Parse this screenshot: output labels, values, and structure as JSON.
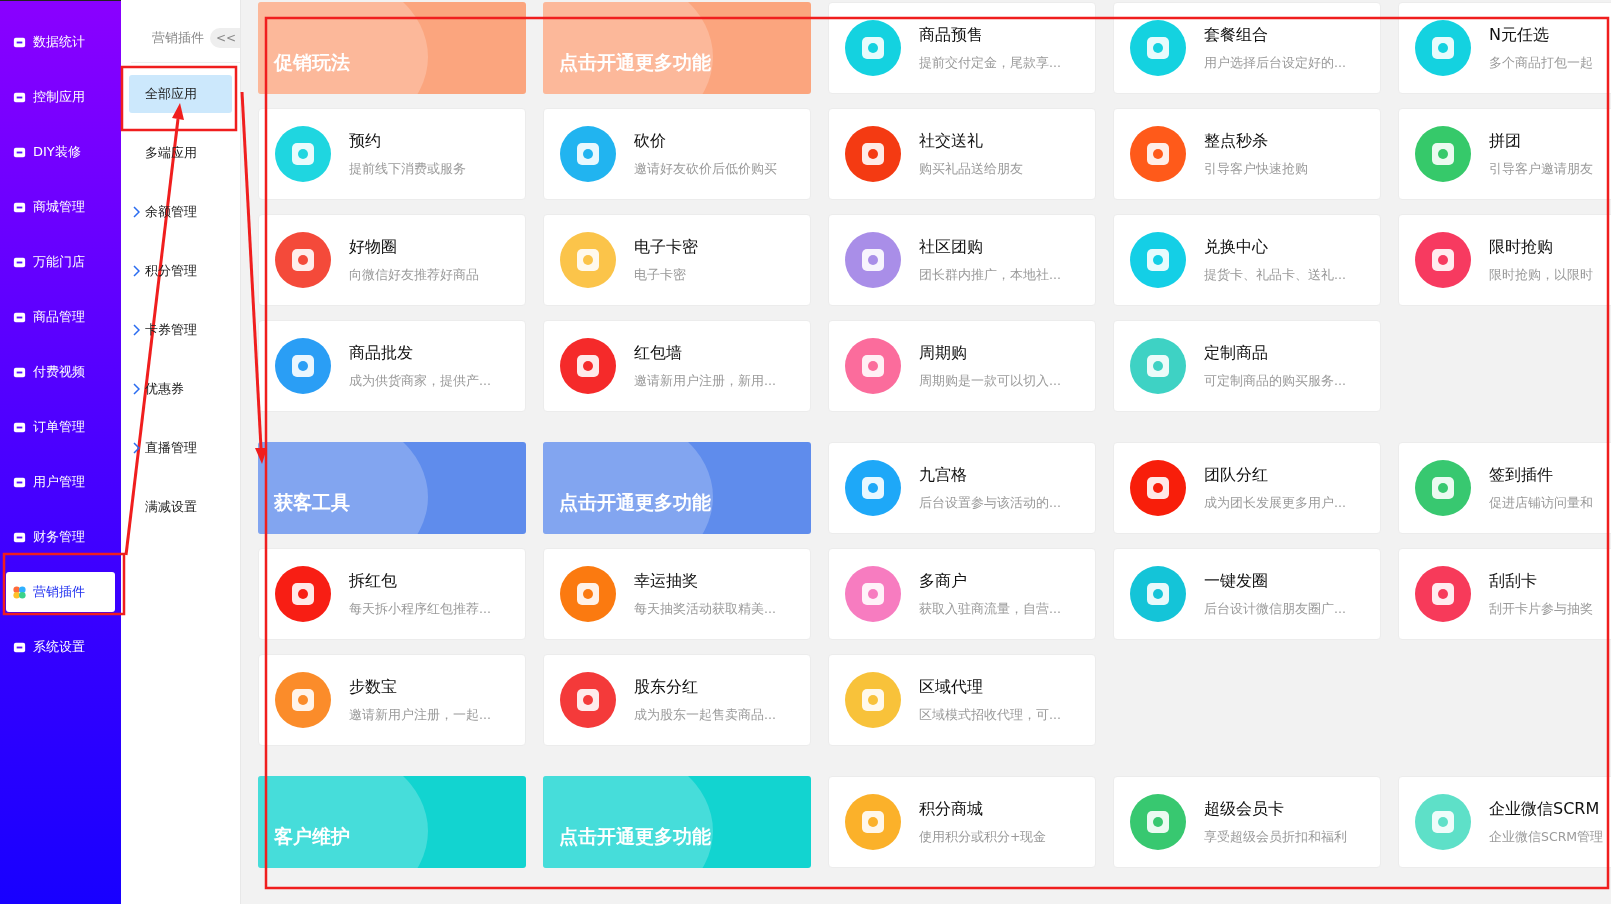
{
  "sidebar": {
    "items": [
      {
        "label": "数据统计",
        "selected": false
      },
      {
        "label": "控制应用",
        "selected": false
      },
      {
        "label": "DIY装修",
        "selected": false
      },
      {
        "label": "商城管理",
        "selected": false
      },
      {
        "label": "万能门店",
        "selected": false
      },
      {
        "label": "商品管理",
        "selected": false
      },
      {
        "label": "付费视频",
        "selected": false
      },
      {
        "label": "订单管理",
        "selected": false
      },
      {
        "label": "用户管理",
        "selected": false
      },
      {
        "label": "财务管理",
        "selected": false
      },
      {
        "label": "营销插件",
        "selected": true
      },
      {
        "label": "系统设置",
        "selected": false
      }
    ]
  },
  "submenu": {
    "title": "营销插件",
    "collapse": "<<",
    "items": [
      {
        "label": "全部应用",
        "kind": "link",
        "selected": true
      },
      {
        "label": "多端应用",
        "kind": "link",
        "selected": false
      },
      {
        "label": "余额管理",
        "kind": "group",
        "selected": false
      },
      {
        "label": "积分管理",
        "kind": "group",
        "selected": false
      },
      {
        "label": "卡券管理",
        "kind": "group",
        "selected": false
      },
      {
        "label": "优惠券",
        "kind": "group",
        "selected": false
      },
      {
        "label": "直播管理",
        "kind": "group",
        "selected": false
      },
      {
        "label": "满减设置",
        "kind": "link",
        "selected": false
      }
    ]
  },
  "sections": [
    {
      "color": "#fba57e",
      "banners": [
        "促销玩法",
        "点击开通更多功能"
      ],
      "apps": [
        {
          "title": "商品预售",
          "desc": "提前交付定金，尾款享...",
          "color": "#14d2e0"
        },
        {
          "title": "套餐组合",
          "desc": "用户选择后台设定好的...",
          "color": "#14d2e0"
        },
        {
          "title": "N元任选",
          "desc": "多个商品打包一起",
          "color": "#14d2e0"
        },
        {
          "title": "预约",
          "desc": "提前线下消费或服务",
          "color": "#1fd6e0"
        },
        {
          "title": "砍价",
          "desc": "邀请好友砍价后低价购买",
          "color": "#21b4f0"
        },
        {
          "title": "社交送礼",
          "desc": "购买礼品送给朋友",
          "color": "#f43a12"
        },
        {
          "title": "整点秒杀",
          "desc": "引导客户快速抢购",
          "color": "#ff5a1a"
        },
        {
          "title": "拼团",
          "desc": "引导客户邀请朋友",
          "color": "#36c96a"
        },
        {
          "title": "好物圈",
          "desc": "向微信好友推荐好商品",
          "color": "#f44a3a"
        },
        {
          "title": "电子卡密",
          "desc": "电子卡密",
          "color": "#fbc44a"
        },
        {
          "title": "社区团购",
          "desc": "团长群内推广，本地社...",
          "color": "#a98ee8"
        },
        {
          "title": "兑换中心",
          "desc": "提货卡、礼品卡、送礼...",
          "color": "#14cfe6"
        },
        {
          "title": "限时抢购",
          "desc": "限时抢购，以限时",
          "color": "#f73a60"
        },
        {
          "title": "商品批发",
          "desc": "成为供货商家，提供产...",
          "color": "#2a9ef5"
        },
        {
          "title": "红包墙",
          "desc": "邀请新用户注册，新用...",
          "color": "#f52a2a"
        },
        {
          "title": "周期购",
          "desc": "周期购是一款可以切入...",
          "color": "#fb6c9c"
        },
        {
          "title": "定制商品",
          "desc": "可定制商品的购买服务...",
          "color": "#3ed2c4"
        }
      ]
    },
    {
      "color": "#5f8cec",
      "banners": [
        "获客工具",
        "点击开通更多功能"
      ],
      "apps": [
        {
          "title": "九宫格",
          "desc": "后台设置参与该活动的...",
          "color": "#1ea8f8"
        },
        {
          "title": "团队分红",
          "desc": "成为团长发展更多用户...",
          "color": "#f81e0a"
        },
        {
          "title": "签到插件",
          "desc": "促进店铺访问量和",
          "color": "#38c870"
        },
        {
          "title": "拆红包",
          "desc": "每天拆小程序红包推荐...",
          "color": "#f81e14"
        },
        {
          "title": "幸运抽奖",
          "desc": "每天抽奖活动获取精美...",
          "color": "#fb7a10"
        },
        {
          "title": "多商户",
          "desc": "获取入驻商流量，自营...",
          "color": "#f77cc0"
        },
        {
          "title": "一键发圈",
          "desc": "后台设计微信朋友圈广...",
          "color": "#14c4d8"
        },
        {
          "title": "刮刮卡",
          "desc": "刮开卡片参与抽奖",
          "color": "#f73a5a"
        },
        {
          "title": "步数宝",
          "desc": "邀请新用户注册，一起...",
          "color": "#fb8c2a"
        },
        {
          "title": "股东分红",
          "desc": "成为股东一起售卖商品...",
          "color": "#f43a3a"
        },
        {
          "title": "区域代理",
          "desc": "区域模式招收代理，可...",
          "color": "#f8c23a"
        }
      ]
    },
    {
      "color": "#12d4d0",
      "banners": [
        "客户维护",
        "点击开通更多功能"
      ],
      "apps": [
        {
          "title": "积分商城",
          "desc": "使用积分或积分+现金",
          "color": "#fbb12a"
        },
        {
          "title": "超级会员卡",
          "desc": "享受超级会员折扣和福利",
          "color": "#38c870"
        },
        {
          "title": "企业微信SCRM",
          "desc": "企业微信SCRM管理",
          "color": "#5ee0c8"
        }
      ]
    }
  ]
}
